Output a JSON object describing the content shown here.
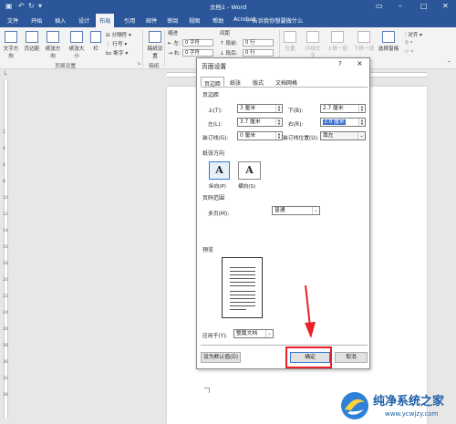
{
  "window": {
    "title": "文档1 - Word"
  },
  "tabs": [
    "文件",
    "开始",
    "插入",
    "设计",
    "布局",
    "引用",
    "邮件",
    "审阅",
    "视图",
    "帮助",
    "Acrobat"
  ],
  "tell_me": "告诉我你想要做什么",
  "ribbon": {
    "text_direction": "文字方向",
    "margins": "页边距",
    "orientation": "纸张方向",
    "size": "纸张大小",
    "columns": "栏",
    "breaks": "分隔符",
    "line_numbers": "行号",
    "hyphenation": "断字",
    "page_setup_group": "页面设置",
    "draft_settings": "稿纸设置",
    "draft_group": "稿纸",
    "indent_header": "缩进",
    "spacing_header": "间距",
    "indent_left_label": "左:",
    "indent_left_value": "0 字符",
    "indent_right_label": "右:",
    "indent_right_value": "0 字符",
    "spacing_before_label": "段前:",
    "spacing_before_value": "0 行",
    "spacing_after_label": "段后:",
    "spacing_after_value": "0 行",
    "position": "位置",
    "wrap_text": "环绕文字",
    "bring_forward": "上移一层",
    "send_backward": "下移一层",
    "selection_pane": "选择窗格",
    "align": "对齐"
  },
  "dialog": {
    "title": "页面设置",
    "help": "?",
    "close": "×",
    "tabs": [
      "页边距",
      "纸张",
      "版式",
      "文档网格"
    ],
    "margins_section": "页边距",
    "top_label": "上(T):",
    "top_value": "3 厘米",
    "bottom_label": "下(B):",
    "bottom_value": "2.7 厘米",
    "left_label": "左(L):",
    "left_value": "3.7 厘米",
    "right_label": "右(R):",
    "right_value": "3.9 厘米",
    "gutter_label": "装订线(G):",
    "gutter_value": "0 厘米",
    "gutter_pos_label": "装订线位置(U):",
    "gutter_pos_value": "靠左",
    "orientation_section": "纸张方向",
    "portrait": "纵向(P)",
    "landscape": "横向(S)",
    "pages_section": "页码范围",
    "multiple_pages_label": "多页(M):",
    "multiple_pages_value": "普通",
    "preview_section": "预览",
    "apply_to_label": "应用于(Y):",
    "apply_to_value": "整篇文档",
    "set_default": "设为默认值(D)",
    "ok": "确定",
    "cancel": "取消"
  },
  "ruler_numbers": [
    "2",
    "4",
    "6",
    "8",
    "10",
    "12",
    "14",
    "16",
    "18",
    "20",
    "22",
    "24",
    "26",
    "28",
    "30",
    "32",
    "34"
  ],
  "watermark": {
    "title": "纯净系统之家",
    "url": "www.ycwjzy.com"
  },
  "colors": {
    "word_blue": "#2b579a",
    "highlight_red": "#e8202a",
    "selection_blue": "#3a6fd0"
  }
}
